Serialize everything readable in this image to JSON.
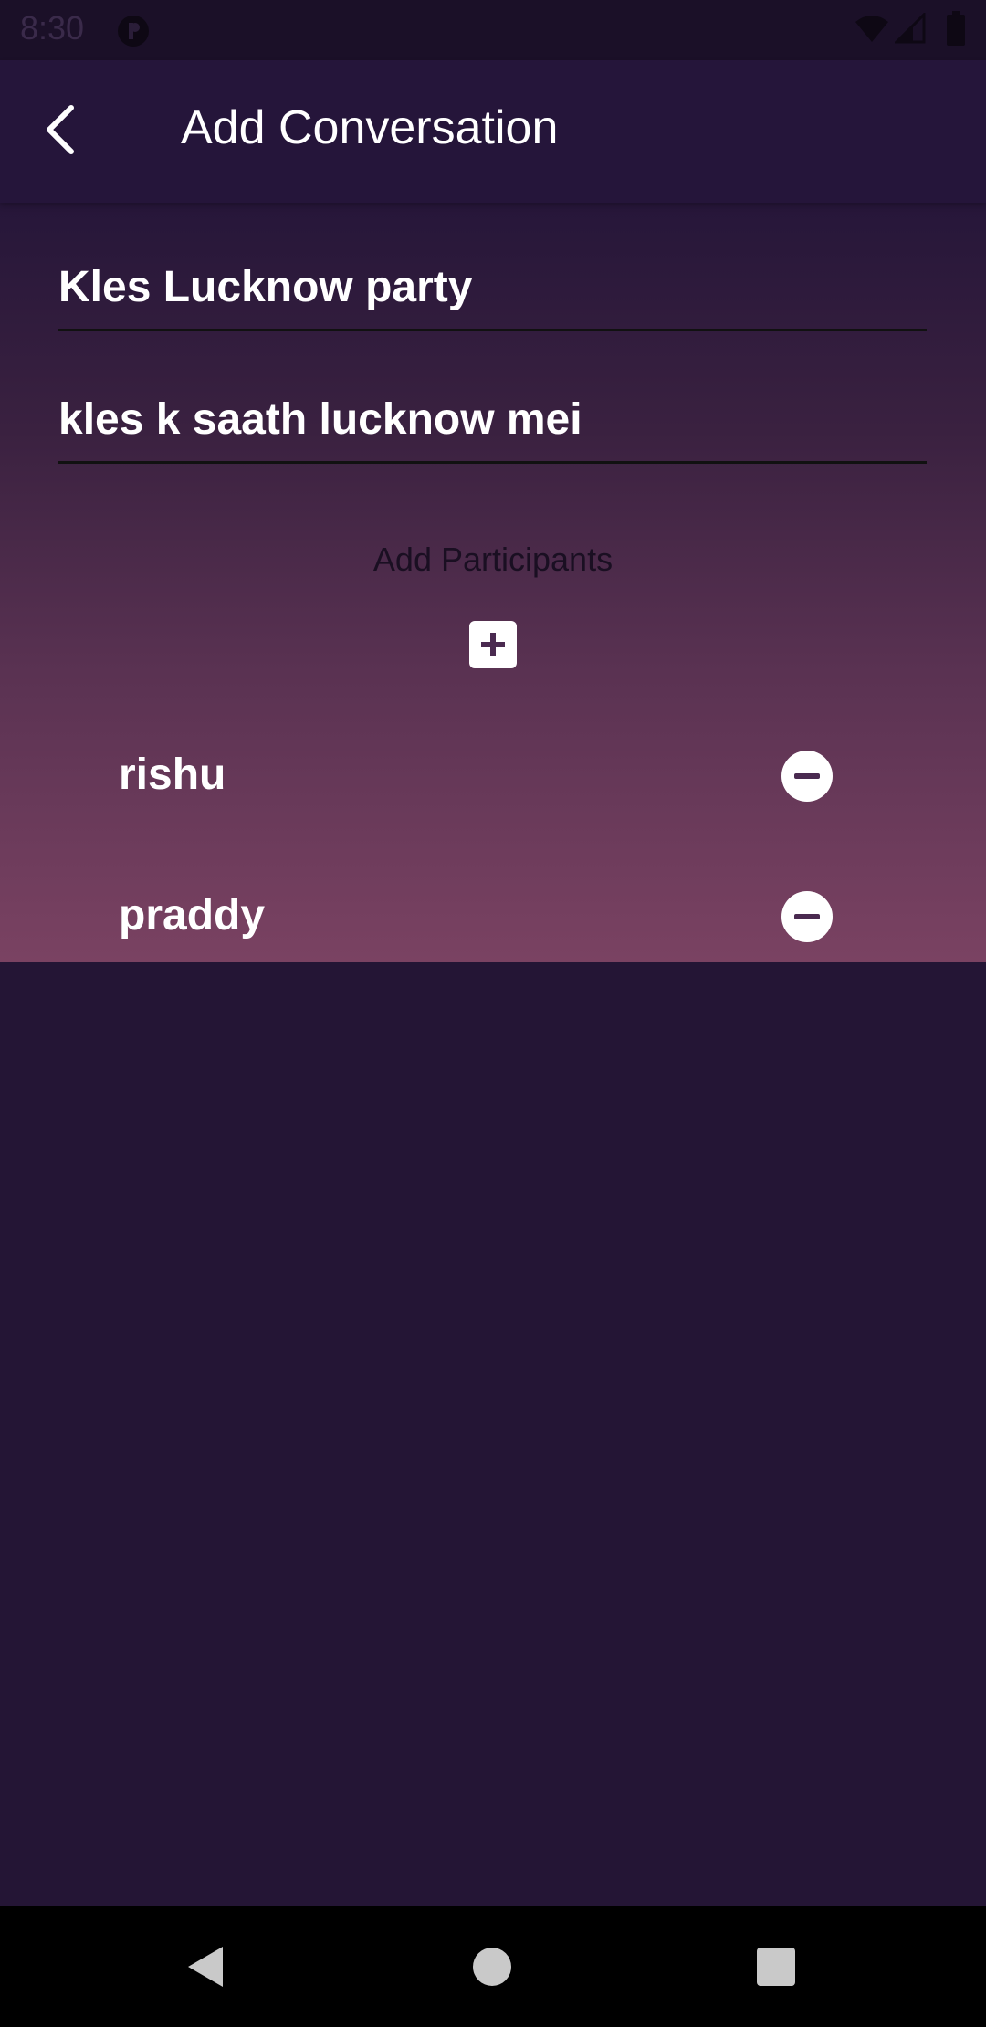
{
  "status_bar": {
    "time": "8:30",
    "icons": [
      "app-notification-icon",
      "wifi-icon",
      "signal-icon",
      "battery-icon"
    ]
  },
  "app_bar": {
    "title": "Add Conversation",
    "back_icon": "chevron-left-icon"
  },
  "form": {
    "name_value": "Kles Lucknow party",
    "description_value": "kles k saath lucknow mei"
  },
  "participants": {
    "heading": "Add Participants",
    "add_icon": "plus-square-icon",
    "items": [
      {
        "name": "rishu",
        "remove_icon": "minus-circle-icon"
      },
      {
        "name": "praddy",
        "remove_icon": "minus-circle-icon"
      }
    ]
  },
  "nav_bar": {
    "icons": [
      "nav-back-icon",
      "nav-home-icon",
      "nav-recents-icon"
    ]
  },
  "colors": {
    "background": "#241535",
    "app_bar": "#25153a",
    "gradient_top": "#261639",
    "gradient_bottom": "#7a4262",
    "text": "#ffffff"
  }
}
